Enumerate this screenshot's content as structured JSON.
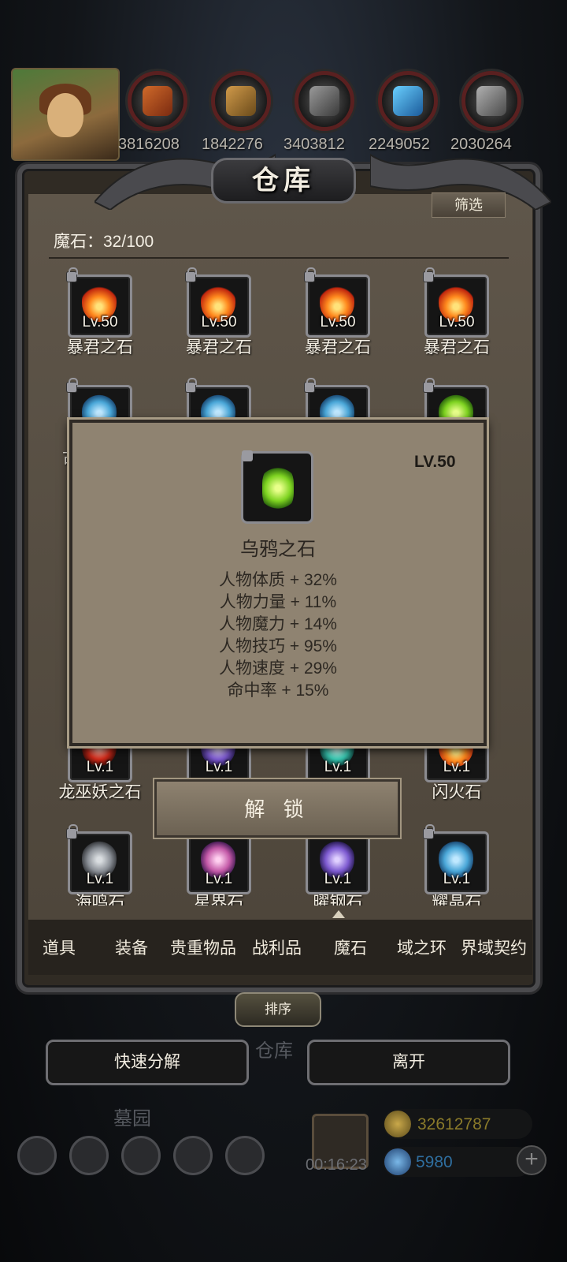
{
  "resources": [
    "3816208",
    "1842276",
    "3403812",
    "2249052",
    "2030264"
  ],
  "panel": {
    "title": "仓库",
    "filter_label": "筛选",
    "stone_count": "魔石：32/100"
  },
  "grid_row1": [
    {
      "level": "Lv.50",
      "name": "暴君之石"
    },
    {
      "level": "Lv.50",
      "name": "暴君之石"
    },
    {
      "level": "Lv.50",
      "name": "暴君之石"
    },
    {
      "level": "Lv.50",
      "name": "暴君之石"
    }
  ],
  "grid_row2_partial_name": "古",
  "grid_row3": [
    {
      "level": "Lv.1",
      "name": "龙巫妖之石"
    },
    {
      "level": "Lv.1",
      "name": ""
    },
    {
      "level": "Lv.1",
      "name": ""
    },
    {
      "level": "Lv.1",
      "name": "闪火石"
    }
  ],
  "grid_row4": [
    {
      "level": "Lv.1",
      "name": "海鸣石"
    },
    {
      "level": "Lv.1",
      "name": "星界石"
    },
    {
      "level": "Lv.1",
      "name": "曜钢石"
    },
    {
      "level": "Lv.1",
      "name": "耀晶石"
    }
  ],
  "tooltip": {
    "level": "LV.50",
    "name": "乌鸦之石",
    "stats": [
      "人物体质 + 32%",
      "人物力量 + 11%",
      "人物魔力 + 14%",
      "人物技巧 + 95%",
      "人物速度 + 29%",
      "命中率 + 15%"
    ],
    "unlock_label": "解 锁"
  },
  "tabs": [
    "道具",
    "装备",
    "贵重物品",
    "战利品",
    "魔石",
    "域之环",
    "界域契约"
  ],
  "active_tab": "魔石",
  "sort_label": "排序",
  "buttons": {
    "quick_decompose": "快速分解",
    "leave": "离开"
  },
  "background": {
    "warehouse_label": "仓库",
    "cemetery_label": "墓园",
    "timer": "00:16:23",
    "gold": "32612787",
    "gems": "5980"
  },
  "colors": {
    "panel_bg": "#5a5145",
    "tooltip_bg": "#8f8371",
    "frame_border": "#8b8b90",
    "gold_text": "#8a7a2a",
    "gem_text": "#2f6fa0"
  }
}
